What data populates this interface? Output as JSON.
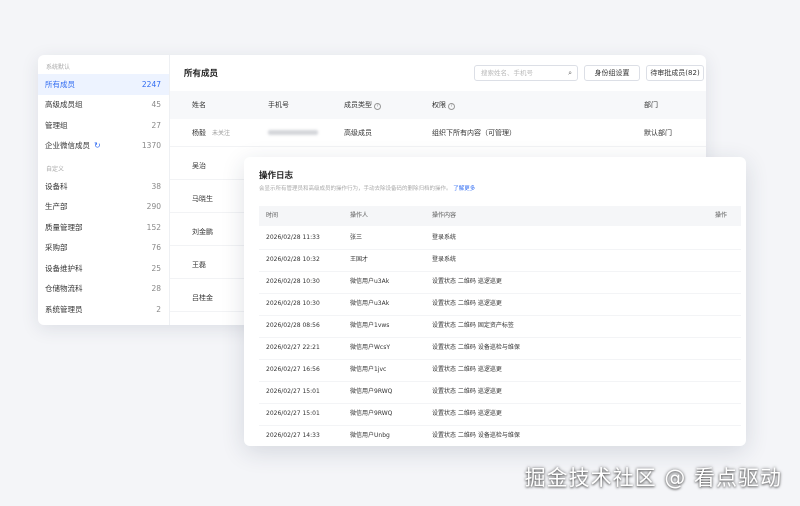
{
  "sidebar": {
    "system_section": "系统默认",
    "system_items": [
      {
        "label": "所有成员",
        "count": "2247"
      },
      {
        "label": "高级成员组",
        "count": "45"
      },
      {
        "label": "管理组",
        "count": "27"
      },
      {
        "label": "企业微信成员",
        "count": "1370"
      }
    ],
    "custom_section": "自定义",
    "custom_items": [
      {
        "label": "设备科",
        "count": "38"
      },
      {
        "label": "生产部",
        "count": "290"
      },
      {
        "label": "质量管理部",
        "count": "152"
      },
      {
        "label": "采购部",
        "count": "76"
      },
      {
        "label": "设备维护科",
        "count": "25"
      },
      {
        "label": "仓储物流科",
        "count": "28"
      },
      {
        "label": "系统管理员",
        "count": "2"
      }
    ]
  },
  "main": {
    "title": "所有成员",
    "search_placeholder": "搜索姓名、手机号",
    "role_button": "身份组设置",
    "pending_button": "待审批成员(82)",
    "columns": [
      "姓名",
      "手机号",
      "成员类型",
      "权限",
      "部门"
    ],
    "rows": [
      {
        "name": "杨毅",
        "follow": "未关注",
        "type": "高级成员",
        "perm": "组织下所有内容（可管理）",
        "dept": "默认部门"
      },
      {
        "name": "吴治"
      },
      {
        "name": "马晓生"
      },
      {
        "name": "刘金鹏"
      },
      {
        "name": "王磊"
      },
      {
        "name": "吕桂金"
      }
    ]
  },
  "log": {
    "title": "操作日志",
    "desc": "会显示所有管理员和高级成员的操作行为，手动去除设备码的删除归档的操作。",
    "more": "了解更多",
    "columns": [
      "时间",
      "操作人",
      "操作内容",
      "操作"
    ],
    "rows": [
      {
        "time": "2026/02/28 11:33",
        "user": "张三",
        "content": "登录系统"
      },
      {
        "time": "2026/02/28 10:32",
        "user": "王国才",
        "content": "登录系统"
      },
      {
        "time": "2026/02/28 10:30",
        "user": "微信用户u3Ak",
        "content": "设置状态 二维码 巡逻巡更"
      },
      {
        "time": "2026/02/28 10:30",
        "user": "微信用户u3Ak",
        "content": "设置状态 二维码 巡逻巡更"
      },
      {
        "time": "2026/02/28 08:56",
        "user": "微信用户1vws",
        "content": "设置状态 二维码 固定资产标签"
      },
      {
        "time": "2026/02/27 22:21",
        "user": "微信用户WcsY",
        "content": "设置状态 二维码 设备巡检与维保"
      },
      {
        "time": "2026/02/27 16:56",
        "user": "微信用户1jvc",
        "content": "设置状态 二维码 巡逻巡更"
      },
      {
        "time": "2026/02/27 15:01",
        "user": "微信用户9RWQ",
        "content": "设置状态 二维码 巡逻巡更"
      },
      {
        "time": "2026/02/27 15:01",
        "user": "微信用户9RWQ",
        "content": "设置状态 二维码 巡逻巡更"
      },
      {
        "time": "2026/02/27 14:33",
        "user": "微信用户Unbg",
        "content": "设置状态 二维码 设备巡检与维保"
      }
    ]
  },
  "watermark": "掘金技术社区 @ 看点驱动"
}
